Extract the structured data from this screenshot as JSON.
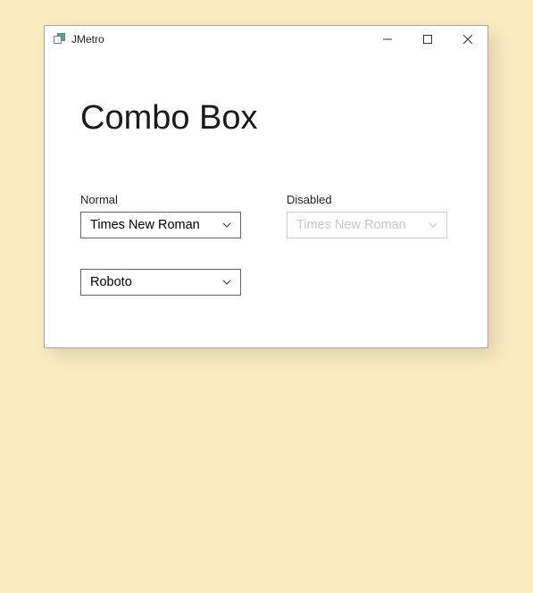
{
  "window": {
    "title": "JMetro"
  },
  "page": {
    "heading": "Combo Box"
  },
  "sections": {
    "normal_label": "Normal",
    "disabled_label": "Disabled"
  },
  "combos": {
    "normal1_value": "Times New Roman",
    "normal2_value": "Roboto",
    "disabled_value": "Times New Roman"
  }
}
